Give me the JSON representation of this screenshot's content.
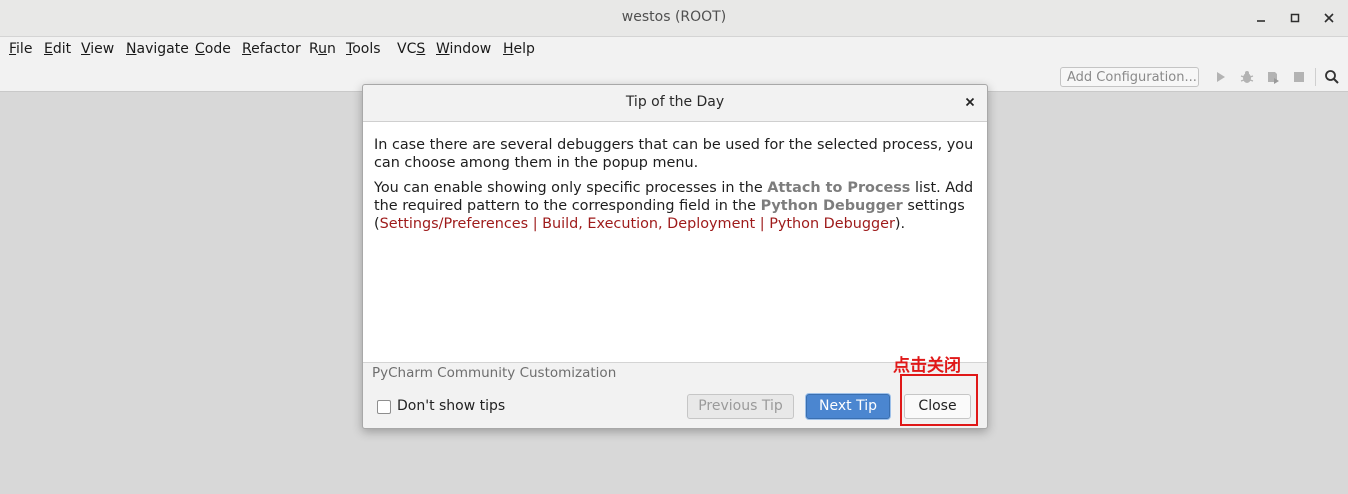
{
  "window": {
    "title": "westos (ROOT)",
    "controls": [
      "minimize-icon",
      "maximize-icon",
      "close-icon"
    ]
  },
  "menu": {
    "items": [
      {
        "pre": "",
        "mn": "F",
        "post": "ile"
      },
      {
        "pre": "",
        "mn": "E",
        "post": "dit"
      },
      {
        "pre": "",
        "mn": "V",
        "post": "iew"
      },
      {
        "pre": "",
        "mn": "N",
        "post": "avigate"
      },
      {
        "pre": "",
        "mn": "C",
        "post": "ode"
      },
      {
        "pre": "",
        "mn": "R",
        "post": "efactor"
      },
      {
        "pre": "R",
        "mn": "u",
        "post": "n"
      },
      {
        "pre": "",
        "mn": "T",
        "post": "ools"
      },
      {
        "pre": "VC",
        "mn": "S",
        "post": ""
      },
      {
        "pre": "",
        "mn": "W",
        "post": "indow"
      },
      {
        "pre": "",
        "mn": "H",
        "post": "elp"
      }
    ]
  },
  "toolbar": {
    "add_configuration": "Add Configuration...",
    "icons": [
      "run-icon",
      "debug-icon",
      "coverage-icon",
      "stop-icon",
      "search-icon"
    ]
  },
  "dialog": {
    "title": "Tip of the Day",
    "paragraph1": "In case there are several debuggers that can be used for the selected process, you can choose among them in the popup menu.",
    "p2_a": "You can enable showing only specific processes in the ",
    "p2_hl1": "Attach to Process",
    "p2_b": " list. Add the required pattern to the corresponding field in the ",
    "p2_hl2": "Python Debugger",
    "p2_c": " settings (",
    "p2_link": "Settings/Preferences | Build, Execution, Deployment | Python Debugger",
    "p2_d": ").",
    "product_label": "PyCharm Community Customization",
    "dont_show_label": "Don't show tips",
    "dont_show_checked": false,
    "prev_button": "Previous Tip",
    "next_button": "Next Tip",
    "close_button": "Close"
  },
  "annotation": {
    "text": "点击关闭",
    "color": "#e01818"
  }
}
